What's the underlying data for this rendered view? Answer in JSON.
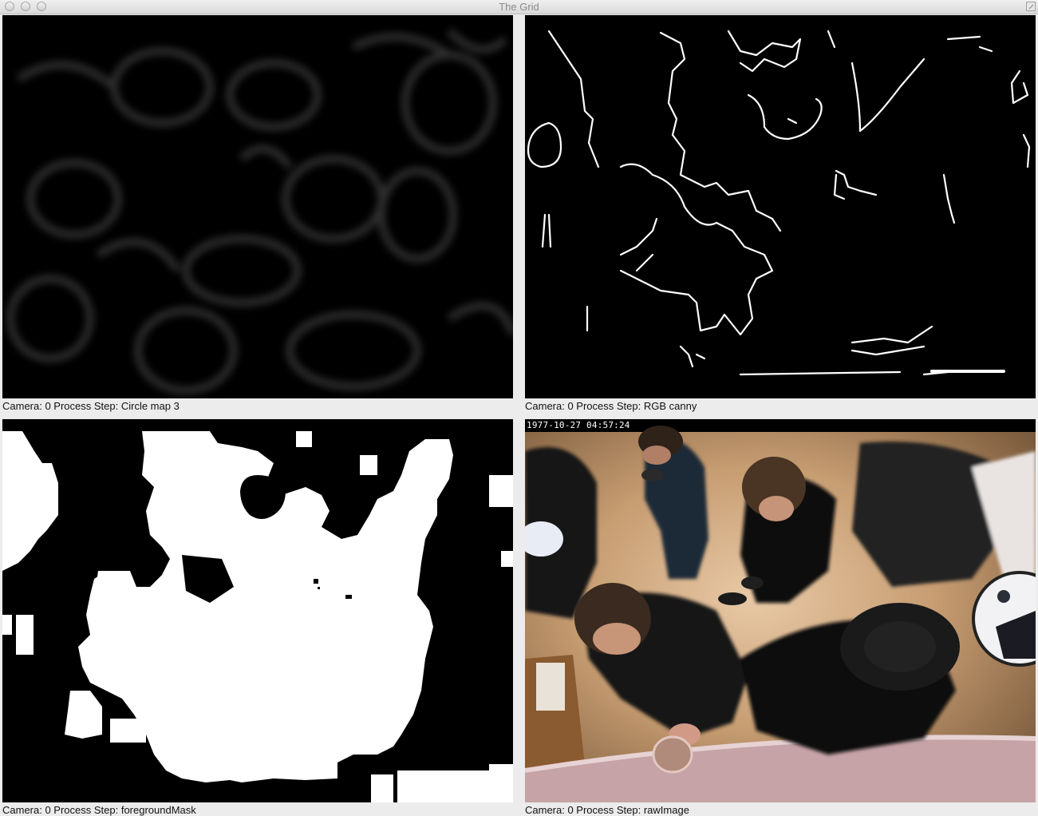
{
  "window": {
    "title": "The Grid"
  },
  "panels": [
    {
      "caption": "Camera: 0 Process Step: Circle map 3",
      "view": "circle-map"
    },
    {
      "caption": "Camera: 0 Process Step: RGB canny",
      "view": "rgb-canny"
    },
    {
      "caption": "Camera: 0 Process Step: foregroundMask",
      "view": "foreground-mask"
    },
    {
      "caption": "Camera: 0 Process Step: rawImage",
      "view": "raw-image",
      "timestamp": "1977-10-27 04:57:24"
    }
  ]
}
